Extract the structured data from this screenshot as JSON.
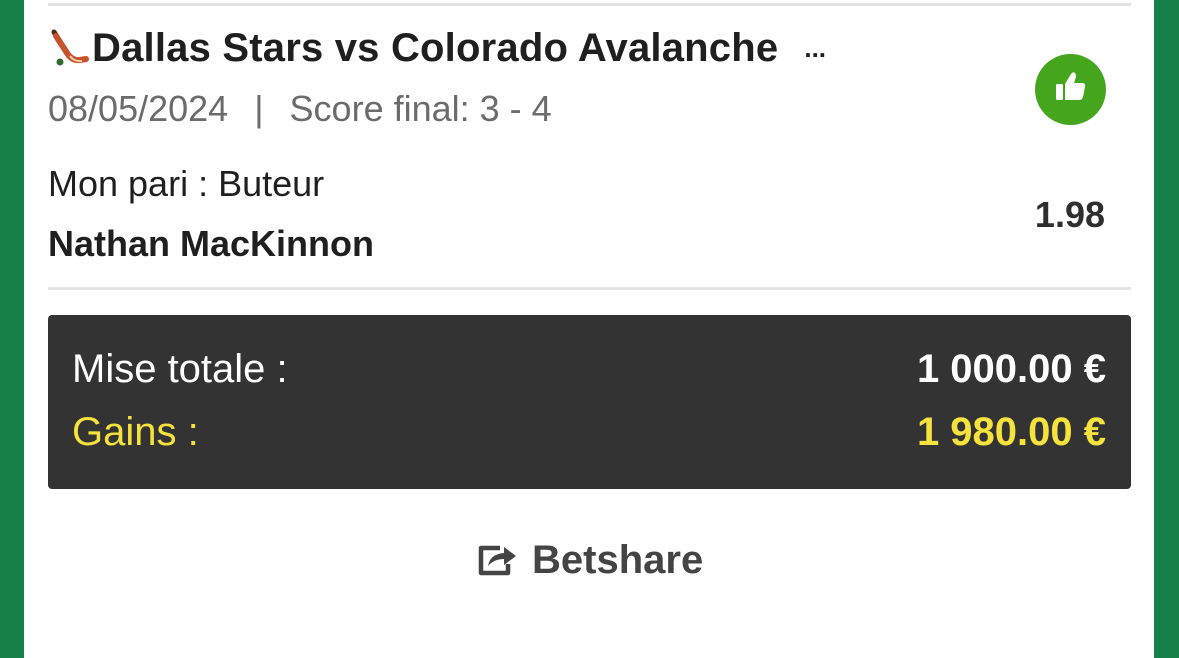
{
  "match": {
    "title": "Dallas Stars vs Colorado Avalanche",
    "more": "...",
    "date": "08/05/2024",
    "separator": "|",
    "score": "Score final: 3 - 4",
    "sport_icon": "hockey-stick-icon",
    "status_icon": "thumbs-up-icon"
  },
  "bet": {
    "type": "Mon pari : Buteur",
    "selection": "Nathan MacKinnon",
    "odds": "1.98"
  },
  "summary": {
    "stake_label": "Mise totale :",
    "stake_value": "1 000.00 €",
    "gains_label": "Gains :",
    "gains_value": "1 980.00 €"
  },
  "betshare": {
    "label": "Betshare",
    "icon": "share-icon"
  },
  "colors": {
    "background": "#17804a",
    "status_win": "#45a51c",
    "gains_text": "#f6e23c",
    "summary_bg": "#333333"
  }
}
